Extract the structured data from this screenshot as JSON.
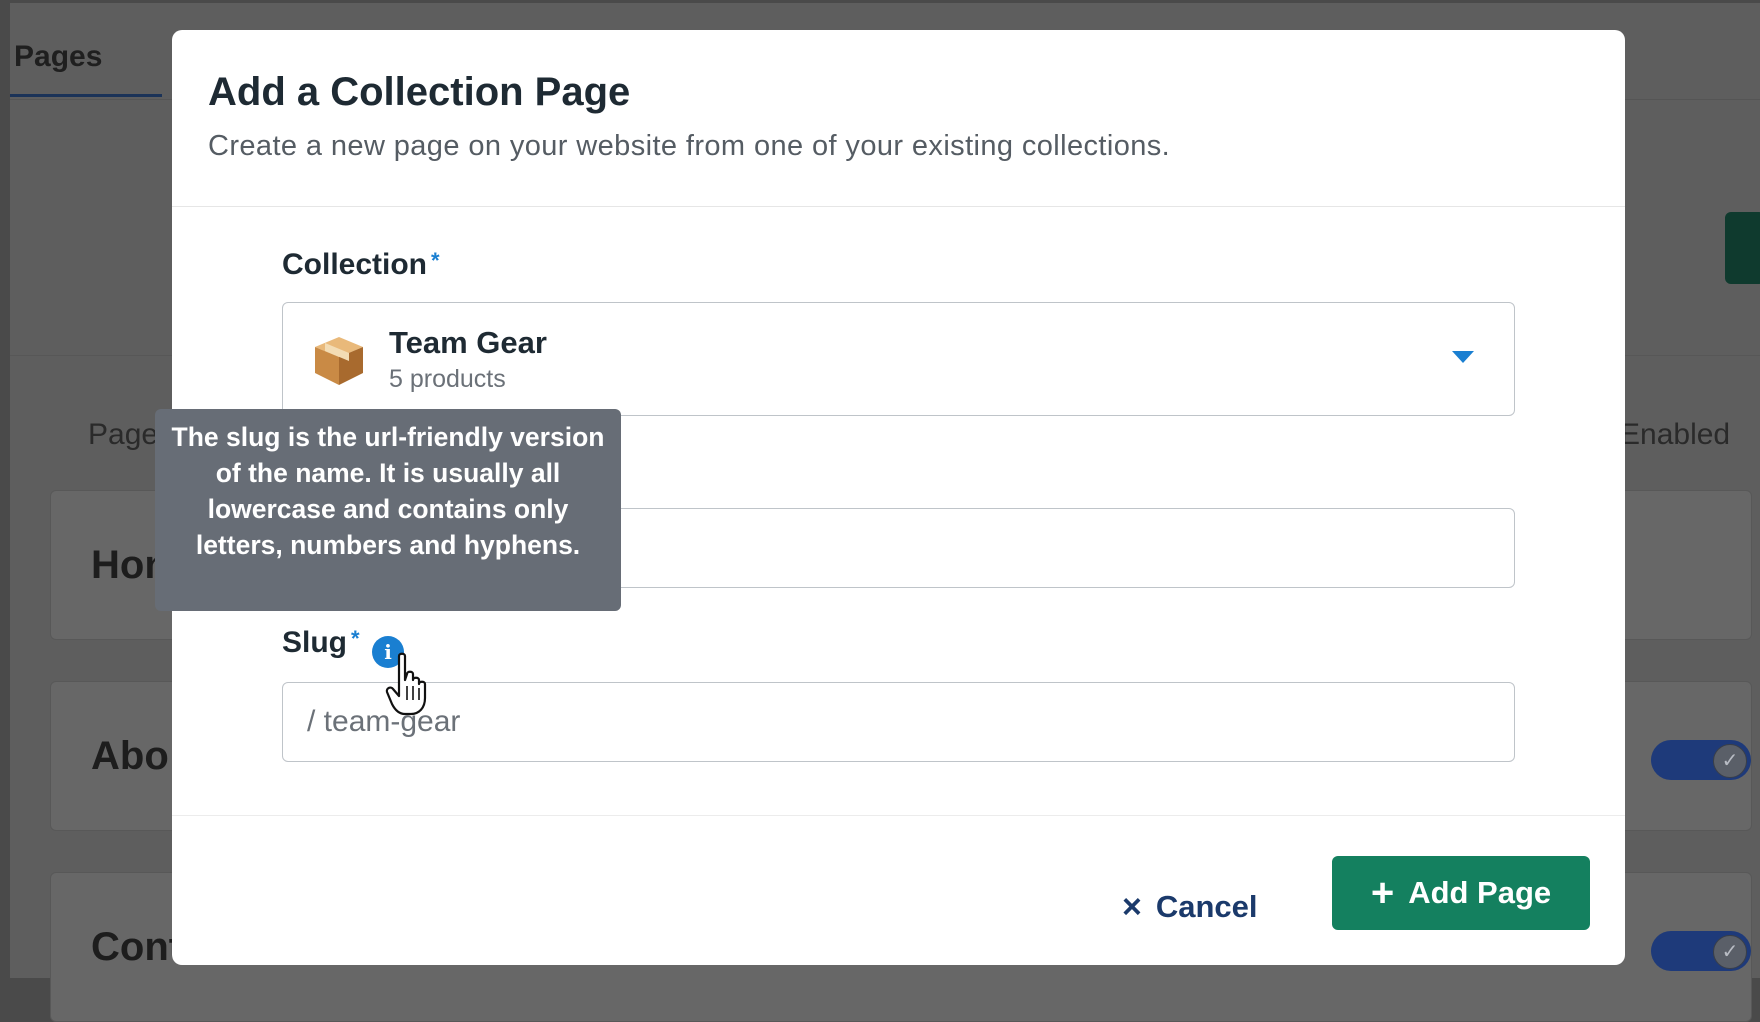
{
  "background": {
    "tab_label": "Pages",
    "column_page": "Page",
    "column_enabled": "Enabled",
    "rows": [
      {
        "label": "Hon"
      },
      {
        "label": "Abo"
      },
      {
        "label": "Cont"
      }
    ],
    "toggle_check": "✓"
  },
  "modal": {
    "title": "Add a Collection Page",
    "subtitle": "Create a new page on your website from one of your existing collections.",
    "collection_label": "Collection",
    "required_marker": "*",
    "collection": {
      "icon": "package-icon",
      "name": "Team Gear",
      "count": "5 products"
    },
    "name_value": "",
    "slug_label": "Slug",
    "slug_value": "/ team-gear",
    "info_glyph": "i",
    "tooltip": "The slug is the url-friendly version of the name. It is usually all lowercase and contains only letters, numbers and hyphens.",
    "cancel_label": "Cancel",
    "cancel_icon": "×",
    "add_label": "Add Page",
    "add_icon": "+"
  },
  "colors": {
    "accent_blue": "#1a7fd1",
    "primary_green": "#14805f",
    "navy_text": "#1b3a6b",
    "tooltip_bg": "#676d76"
  }
}
